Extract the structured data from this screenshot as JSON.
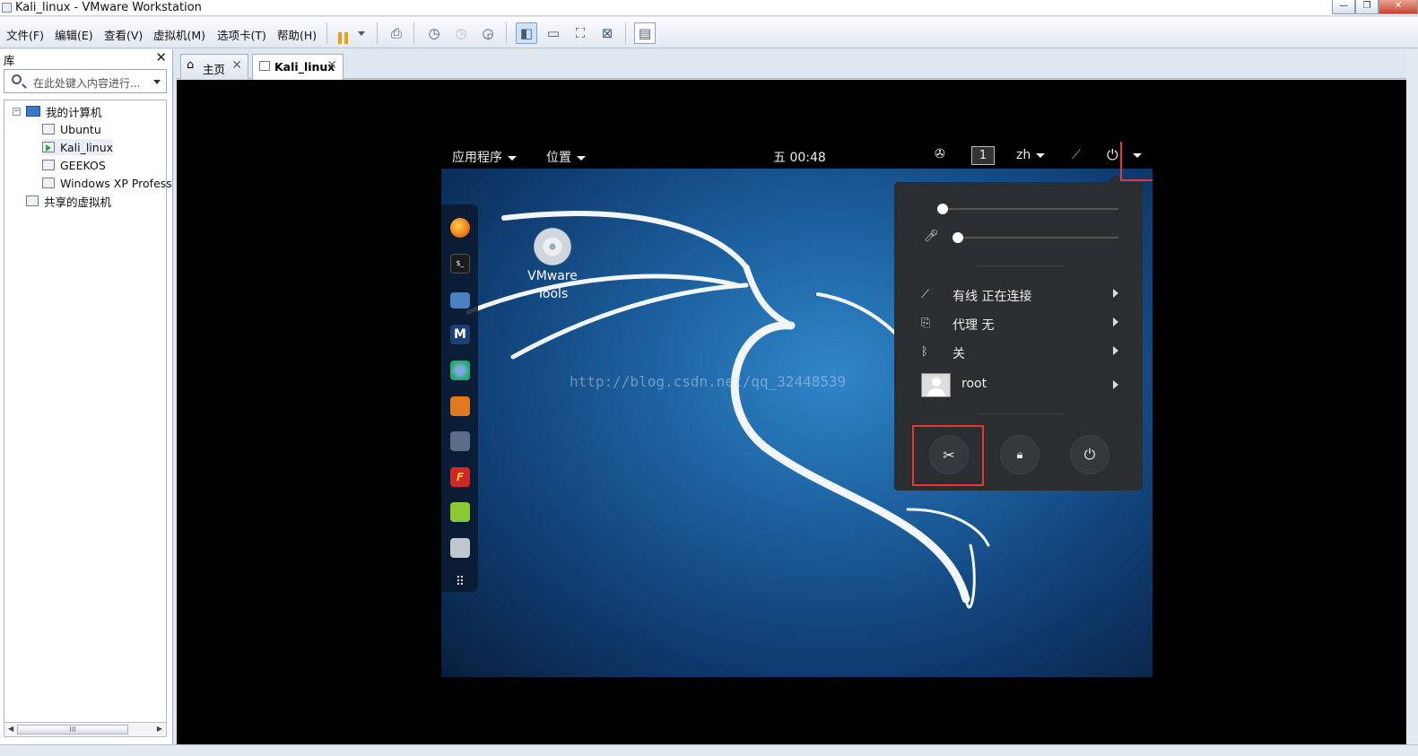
{
  "window": {
    "title": "Kali_linux - VMware Workstation"
  },
  "menu": [
    "文件(F)",
    "编辑(E)",
    "查看(V)",
    "虚拟机(M)",
    "选项卡(T)",
    "帮助(H)"
  ],
  "library": {
    "title": "库",
    "search_placeholder": "在此处键入内容进行...",
    "tree": {
      "root": "我的计算机",
      "vms": [
        "Ubuntu",
        "Kali_linux",
        "GEEKOS",
        "Windows XP Profess"
      ],
      "shared": "共享的虚拟机"
    }
  },
  "tabs": [
    {
      "label": "主页",
      "icon": "home-icon"
    },
    {
      "label": "Kali_linux",
      "icon": "vm-icon"
    }
  ],
  "guest": {
    "topbar": {
      "apps": "应用程序",
      "places": "位置",
      "clock": "五 00:48",
      "workspace": "1",
      "lang": "zh"
    },
    "desktop_icon": {
      "line1": "VMware",
      "line2": "Tools"
    },
    "watermark": "http://blog.csdn.net/qq_32448539",
    "system_menu": {
      "volume_level": 0,
      "mic_level": 0,
      "wired": "有线 正在连接",
      "proxy": "代理 无",
      "bluetooth": "关",
      "user": "root"
    }
  },
  "colors": {
    "highlight": "#e33333",
    "menu_bg": "#2b2e30",
    "wallpaper": "#1c5f9e"
  }
}
